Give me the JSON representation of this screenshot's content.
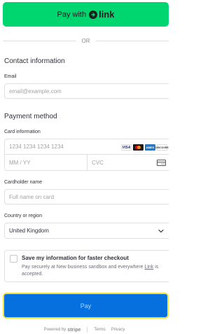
{
  "link_button": {
    "prefix": "Pay with",
    "brand": "link"
  },
  "divider": {
    "text": "OR"
  },
  "contact": {
    "title": "Contact information",
    "email_label": "Email",
    "email_placeholder": "email@example.com"
  },
  "payment": {
    "title": "Payment method",
    "card_label": "Card information",
    "card_number_placeholder": "1234 1234 1234 1234",
    "expiry_placeholder": "MM / YY",
    "cvc_placeholder": "CVC",
    "brands": [
      "visa",
      "mastercard",
      "amex",
      "discover"
    ],
    "brand_labels": {
      "visa": "VISA",
      "amex": "AMEX",
      "discover": "DISCOVER"
    },
    "cvc_icon_text": "123",
    "cardholder_label": "Cardholder name",
    "cardholder_placeholder": "Full name on card",
    "country_label": "Country or region",
    "country_value": "United Kingdom"
  },
  "save_info": {
    "title": "Save my information for faster checkout",
    "desc_before": "Pay securely at New business sandbox and everywhere ",
    "desc_link": "Link",
    "desc_after": " is accepted."
  },
  "pay_button": {
    "label": "Pay"
  },
  "footer": {
    "powered_by": "Powered by",
    "stripe": "stripe",
    "terms": "Terms",
    "privacy": "Privacy"
  },
  "colors": {
    "link_green": "#00d66f",
    "pay_blue": "#0570de",
    "focus_ring": "#f5e13a"
  }
}
